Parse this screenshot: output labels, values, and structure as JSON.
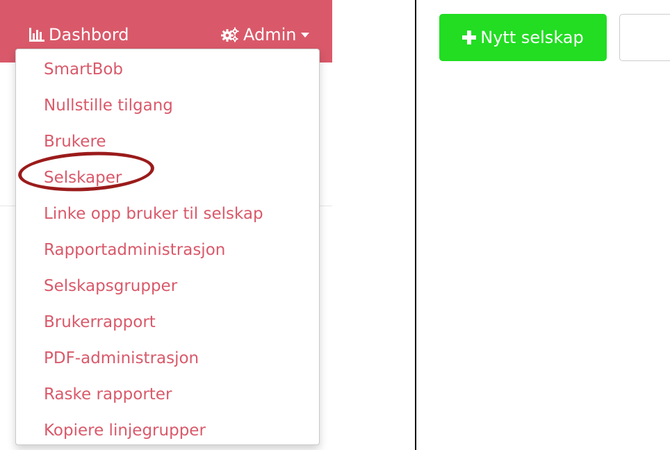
{
  "navbar": {
    "dashboard_label": "Dashbord",
    "admin_label": "Admin",
    "background_color": "#d9596a",
    "text_color": "#ffffff"
  },
  "dropdown": {
    "items": [
      {
        "label": "SmartBob"
      },
      {
        "label": "Nullstille tilgang"
      },
      {
        "label": "Brukere"
      },
      {
        "label": "Selskaper"
      },
      {
        "label": "Linke opp bruker til selskap"
      },
      {
        "label": "Rapportadministrasjon"
      },
      {
        "label": "Selskapsgrupper"
      },
      {
        "label": "Brukerrapport"
      },
      {
        "label": "PDF-administrasjon"
      },
      {
        "label": "Raske rapporter"
      },
      {
        "label": "Kopiere linjegrupper"
      }
    ],
    "highlighted_item": "Selskaper",
    "item_color": "#d9596a",
    "highlight_color": "#9b1b1b"
  },
  "toolbar": {
    "new_company_label": "Nytt selskap",
    "new_company_color": "#22dd22"
  },
  "icons": {
    "dashboard": "bar-chart-icon",
    "admin": "gears-icon",
    "dropdown": "caret-down-icon",
    "new": "plus-icon"
  }
}
